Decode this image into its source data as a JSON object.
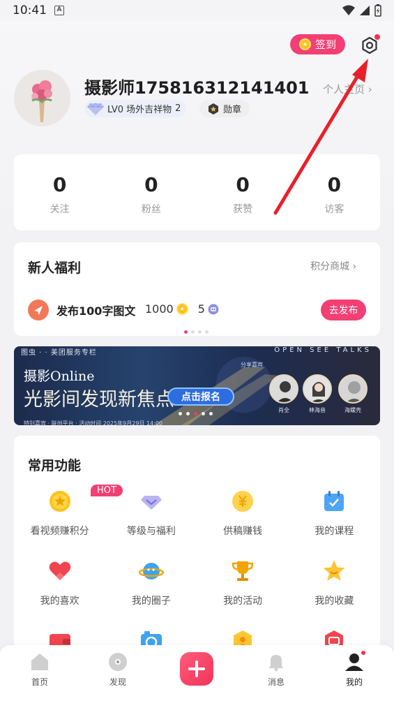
{
  "status_bar": {
    "time": "10:41",
    "notif_letter": "A"
  },
  "header": {
    "signin_label": "签到",
    "username": "摄影师17581631214140​1",
    "homepage_label": "个人主页 ›",
    "level_text": "LV0 场外吉祥物",
    "level_count": "2",
    "medal_label": "勋章"
  },
  "stats": [
    {
      "value": "0",
      "label": "关注"
    },
    {
      "value": "0",
      "label": "粉丝"
    },
    {
      "value": "0",
      "label": "获赞"
    },
    {
      "value": "0",
      "label": "访客"
    }
  ],
  "newuser": {
    "title": "新人福利",
    "more": "积分商城 ›",
    "task": "发布100字图文",
    "points": "1000",
    "count": "5",
    "button": "去发布"
  },
  "banner": {
    "top_logos": "图虫  ·  ·  美团服务专栏",
    "open_text": "OPEN SEE TALKS",
    "title_small": "摄影Online",
    "title_big": "光影间发现新焦点",
    "button": "点击报名",
    "share_label": "分享嘉宾",
    "speakers": [
      "肖全",
      "林海音",
      "海螺壳"
    ],
    "bottom_text": "特别嘉宾  ·  联创平台  ·  活动时间 2025年9月29日 14:00"
  },
  "functions": {
    "title": "常用功能",
    "hot_badge": "HOT",
    "items": [
      {
        "label": "看视频赚积分",
        "icon": "coin-icon"
      },
      {
        "label": "等级与福利",
        "icon": "diamond-icon"
      },
      {
        "label": "供稿赚钱",
        "icon": "yen-icon"
      },
      {
        "label": "我的课程",
        "icon": "calendar-icon"
      },
      {
        "label": "我的喜欢",
        "icon": "heart-icon"
      },
      {
        "label": "我的圈子",
        "icon": "planet-icon"
      },
      {
        "label": "我的活动",
        "icon": "trophy-icon"
      },
      {
        "label": "我的收藏",
        "icon": "star-icon"
      },
      {
        "label": "",
        "icon": "wallet-icon"
      },
      {
        "label": "",
        "icon": "camera-icon"
      },
      {
        "label": "",
        "icon": "group-icon"
      },
      {
        "label": "",
        "icon": "tag-icon"
      }
    ]
  },
  "tabbar": {
    "home": "首页",
    "discover": "发现",
    "messages": "消息",
    "mine": "我的"
  },
  "colors": {
    "accent": "#f33f74",
    "arrow": "#e8202a"
  }
}
